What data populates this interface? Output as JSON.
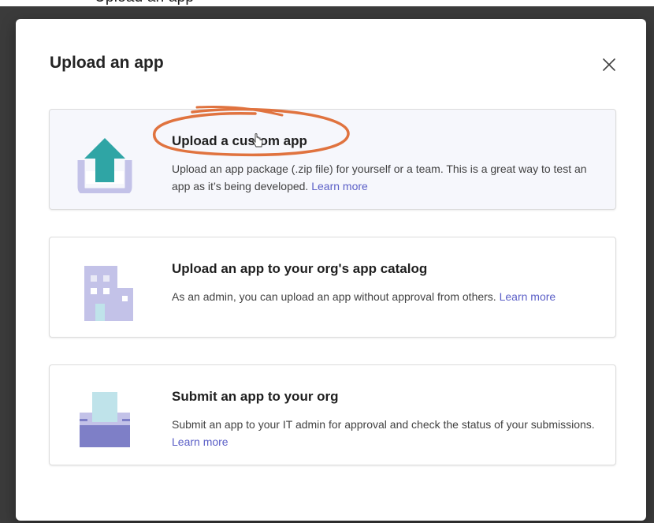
{
  "top_strip": {
    "text": "Upload an app"
  },
  "dialog": {
    "title": "Upload an app",
    "close_label": "Close"
  },
  "options": [
    {
      "title": "Upload a custom app",
      "description": "Upload an app package (.zip file) for yourself or a team. This is a great way to test an app as it’s being developed.",
      "link": "Learn more",
      "icon": "upload-icon"
    },
    {
      "title": "Upload an app to your org's app catalog",
      "description": "As an admin, you can upload an app without approval from others.",
      "link": "Learn more",
      "icon": "building-icon"
    },
    {
      "title": "Submit an app to your org",
      "description": "Submit an app to your IT admin for approval and check the status of your submissions.",
      "link": "Learn more",
      "icon": "submit-box-icon"
    }
  ],
  "colors": {
    "accent": "#5b5fc7",
    "upload_arrow": "#2fa5a5",
    "icon_lavender": "#c3c2e8",
    "icon_purple": "#7e7fc7",
    "annotation": "#e0733f",
    "backdrop": "#3b3b3b"
  }
}
